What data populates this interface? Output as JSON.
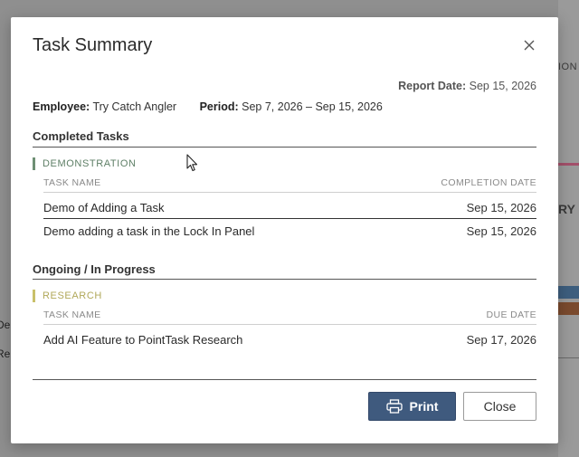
{
  "background": {
    "right_fragment_1": "ION",
    "right_fragment_2": "RY",
    "left_fragment_1": "De",
    "left_fragment_2": "Re",
    "left_fragment_3": "l"
  },
  "modal": {
    "title": "Task Summary",
    "close_icon": "close-icon",
    "report_date_label": "Report Date:",
    "report_date_value": "Sep 15, 2026",
    "employee_label": "Employee:",
    "employee_value": "Try Catch Angler",
    "period_label": "Period:",
    "period_value": "Sep 7, 2026 – Sep 15, 2026"
  },
  "completed": {
    "title": "Completed Tasks",
    "group": "DEMONSTRATION",
    "col_name": "TASK NAME",
    "col_date": "COMPLETION DATE",
    "rows": [
      {
        "name": "Demo of Adding a Task",
        "date": "Sep 15, 2026"
      },
      {
        "name": "Demo adding a task in the Lock In Panel",
        "date": "Sep 15, 2026"
      }
    ]
  },
  "ongoing": {
    "title": "Ongoing / In Progress",
    "group": "RESEARCH",
    "col_name": "TASK NAME",
    "col_date": "DUE DATE",
    "rows": [
      {
        "name": "Add AI Feature to PointTask Research",
        "date": "Sep 17, 2026"
      }
    ]
  },
  "footer": {
    "print_label": "Print",
    "print_icon": "printer-icon",
    "close_label": "Close"
  },
  "colors": {
    "primary_button": "#3f5a7e",
    "demo_accent": "#6e8f74",
    "research_accent": "#c9c06a"
  }
}
